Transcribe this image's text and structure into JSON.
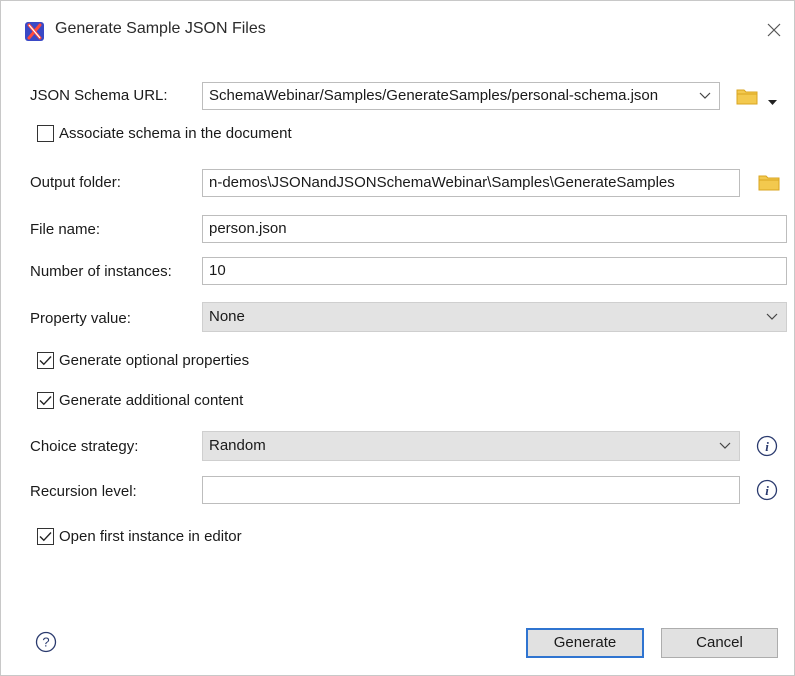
{
  "window": {
    "title": "Generate Sample JSON Files",
    "icon": "oxygen-x-app-icon",
    "close_icon": "close-icon"
  },
  "form": {
    "schema_url": {
      "label": "JSON Schema URL:",
      "value": "SchemaWebinar/Samples/GenerateSamples/personal-schema.json"
    },
    "associate_schema": {
      "label": "Associate schema in the document",
      "checked": false
    },
    "output_folder": {
      "label": "Output folder:",
      "value": "n-demos\\JSONandJSONSchemaWebinar\\Samples\\GenerateSamples"
    },
    "file_name": {
      "label": "File name:",
      "value": "person.json"
    },
    "instances": {
      "label": "Number of instances:",
      "value": "10"
    },
    "property_value": {
      "label": "Property value:",
      "value": "None"
    },
    "generate_optional": {
      "label": "Generate optional properties",
      "checked": true
    },
    "generate_additional": {
      "label": "Generate additional content",
      "checked": true
    },
    "choice_strategy": {
      "label": "Choice strategy:",
      "value": "Random"
    },
    "recursion_level": {
      "label": "Recursion level:",
      "value": ""
    },
    "open_first": {
      "label": "Open first instance in editor",
      "checked": true
    }
  },
  "buttons": {
    "generate": "Generate",
    "cancel": "Cancel"
  },
  "colors": {
    "accent": "#2f74d0",
    "folder": "#e8b83a",
    "combo_bg": "#e3e3e3"
  }
}
